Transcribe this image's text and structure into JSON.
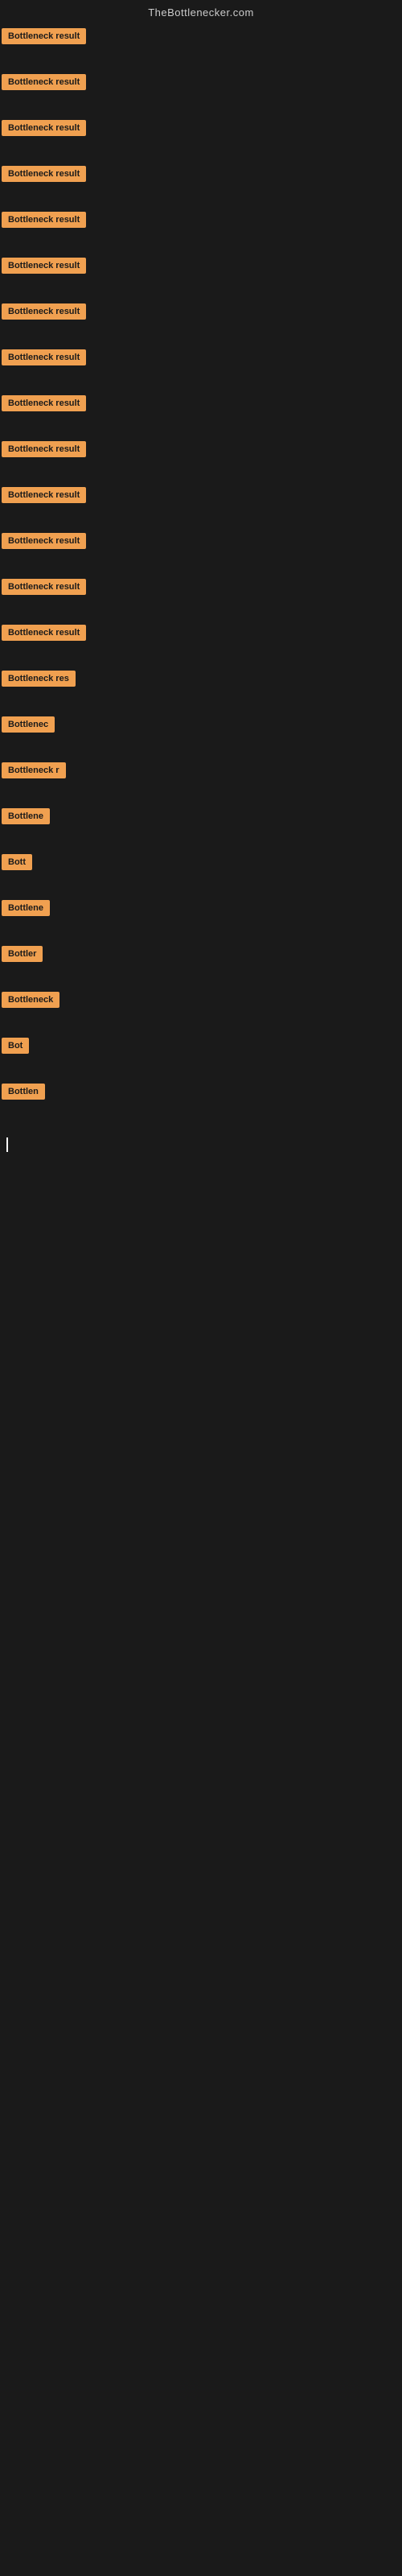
{
  "header": {
    "title": "TheBottlenecker.com"
  },
  "rows": [
    {
      "id": 1,
      "label": "Bottleneck result",
      "width": 130
    },
    {
      "id": 2,
      "label": "Bottleneck result",
      "width": 130
    },
    {
      "id": 3,
      "label": "Bottleneck result",
      "width": 130
    },
    {
      "id": 4,
      "label": "Bottleneck result",
      "width": 130
    },
    {
      "id": 5,
      "label": "Bottleneck result",
      "width": 130
    },
    {
      "id": 6,
      "label": "Bottleneck result",
      "width": 130
    },
    {
      "id": 7,
      "label": "Bottleneck result",
      "width": 130
    },
    {
      "id": 8,
      "label": "Bottleneck result",
      "width": 130
    },
    {
      "id": 9,
      "label": "Bottleneck result",
      "width": 130
    },
    {
      "id": 10,
      "label": "Bottleneck result",
      "width": 130
    },
    {
      "id": 11,
      "label": "Bottleneck result",
      "width": 130
    },
    {
      "id": 12,
      "label": "Bottleneck result",
      "width": 130
    },
    {
      "id": 13,
      "label": "Bottleneck result",
      "width": 130
    },
    {
      "id": 14,
      "label": "Bottleneck result",
      "width": 130
    },
    {
      "id": 15,
      "label": "Bottleneck res",
      "width": 110
    },
    {
      "id": 16,
      "label": "Bottlenec",
      "width": 80
    },
    {
      "id": 17,
      "label": "Bottleneck r",
      "width": 90
    },
    {
      "id": 18,
      "label": "Bottlene",
      "width": 75
    },
    {
      "id": 19,
      "label": "Bott",
      "width": 48
    },
    {
      "id": 20,
      "label": "Bottlene",
      "width": 75
    },
    {
      "id": 21,
      "label": "Bottler",
      "width": 60
    },
    {
      "id": 22,
      "label": "Bottleneck",
      "width": 78
    },
    {
      "id": 23,
      "label": "Bot",
      "width": 40
    },
    {
      "id": 24,
      "label": "Bottlen",
      "width": 64
    }
  ],
  "colors": {
    "badge_bg": "#f0a050",
    "badge_text": "#1a1a1a",
    "page_bg": "#1a1a1a",
    "header_text": "#cccccc"
  }
}
